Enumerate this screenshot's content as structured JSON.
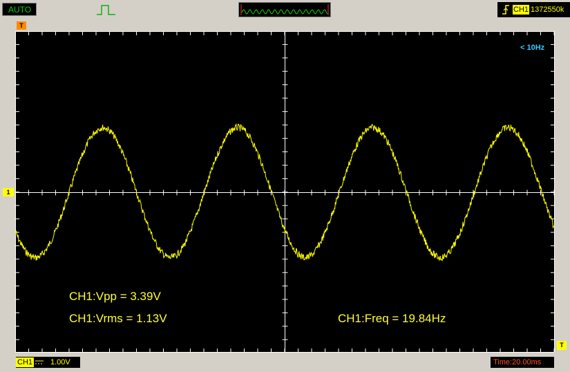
{
  "topbar": {
    "mode_label": "AUTO",
    "trigger_channel": "CH1",
    "trigger_value": "1372550k"
  },
  "markers": {
    "trigger_pos": "T",
    "trigger_level": "T",
    "channel_ref": "1"
  },
  "screen": {
    "freq_flag": "< 10Hz",
    "measurements": {
      "vpp": "CH1:Vpp = 3.39V",
      "vrms": "CH1:Vrms = 1.13V",
      "freq": "CH1:Freq = 19.84Hz"
    }
  },
  "bottombar": {
    "channel_label": "CH1",
    "volts_per_div": "1.00V",
    "timebase": "Time:20.00ms"
  },
  "colors": {
    "trace": "#ffff00",
    "grid": "#ffffff",
    "background": "#000000",
    "mode_text": "#10d010",
    "freq_flag": "#33ccff",
    "timebase": "#ff5020"
  }
}
